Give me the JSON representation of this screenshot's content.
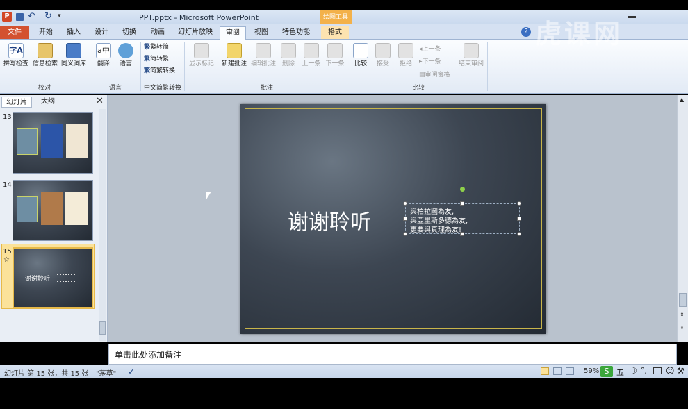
{
  "app": {
    "title": "PPT.pptx - Microsoft PowerPoint",
    "contextual_tab_group": "绘图工具",
    "watermark": "虎课网"
  },
  "ribbon_tabs": [
    "文件",
    "开始",
    "插入",
    "设计",
    "切换",
    "动画",
    "幻灯片放映",
    "审阅",
    "视图",
    "特色功能",
    "格式"
  ],
  "active_tab": "审阅",
  "groups": {
    "proofing": {
      "label": "校对",
      "buttons": [
        "拼写检查",
        "信息检索",
        "同义词库"
      ]
    },
    "language": {
      "label": "语言",
      "buttons": [
        "翻译",
        "语言"
      ]
    },
    "chinese_convert": {
      "label": "中文简繁转换",
      "buttons": [
        "繁转简",
        "简转繁",
        "简繁转换"
      ]
    },
    "comments": {
      "label": "批注",
      "buttons": [
        "显示标记",
        "新建批注",
        "编辑批注",
        "删除",
        "上一条",
        "下一条"
      ]
    },
    "compare": {
      "label": "比较",
      "buttons": [
        "比较",
        "接受",
        "拒绝",
        "上一条",
        "下一条",
        "审阅窗格",
        "结束审阅"
      ]
    }
  },
  "left_pane": {
    "tabs": [
      "幻灯片",
      "大纲"
    ],
    "slide_numbers": [
      "13",
      "14",
      "15"
    ],
    "star": "☆"
  },
  "slide": {
    "title": "谢谢聆听",
    "quote_lines": [
      "與柏拉圖為友,",
      "與亞里斯多德為友,",
      "更要與真理為友!"
    ]
  },
  "notes_placeholder": "单击此处添加备注",
  "status": {
    "slide_info": "幻灯片 第 15 张，共 15 张",
    "theme": "\"茅草\"",
    "zoom": "59%",
    "ime": "五"
  }
}
